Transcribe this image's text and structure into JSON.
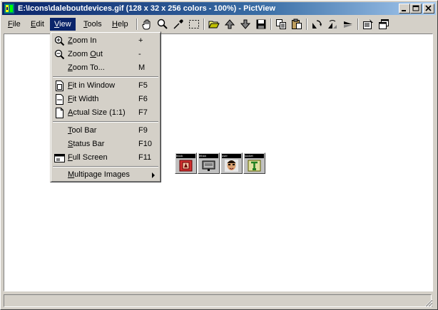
{
  "window": {
    "title": "E:\\Icons\\daleboutdevices.gif (128 x 32 x 256 colors - 100%) - PictView",
    "controls": [
      "minimize",
      "maximize",
      "close"
    ]
  },
  "menubar": {
    "items": [
      {
        "label": "File",
        "accel": "F",
        "rest": "ile"
      },
      {
        "label": "Edit",
        "accel": "E",
        "rest": "dit"
      },
      {
        "label": "View",
        "accel": "V",
        "rest": "iew"
      },
      {
        "label": "Tools",
        "accel": "T",
        "rest": "ools"
      },
      {
        "label": "Help",
        "accel": "H",
        "rest": "elp"
      }
    ]
  },
  "toolbar": {
    "icons": [
      "hand-icon",
      "zoom-icon",
      "eyedropper-icon",
      "selection-icon",
      "open-folder-icon",
      "previous-icon",
      "next-icon",
      "save-icon",
      "copy-icon",
      "paste-icon",
      "rotate-icon",
      "flip-icon",
      "mirror-icon",
      "properties-icon",
      "window-icon"
    ]
  },
  "view_menu": {
    "items": [
      {
        "pre": "",
        "accel": "Z",
        "rest": "oom In",
        "shortcut": "+",
        "icon": "zoom-in-icon"
      },
      {
        "pre": "Zoom ",
        "accel": "O",
        "rest": "ut",
        "shortcut": "-",
        "icon": "zoom-out-icon"
      },
      {
        "pre": "",
        "accel": "Z",
        "rest": "oom To...",
        "shortcut": "M",
        "icon": ""
      },
      {
        "pre": "",
        "accel": "F",
        "rest": "it in Window",
        "shortcut": "F5",
        "icon": "fit-window-icon"
      },
      {
        "pre": "",
        "accel": "F",
        "rest": "it Width",
        "shortcut": "F6",
        "icon": "fit-width-icon"
      },
      {
        "pre": "",
        "accel": "A",
        "rest": "ctual Size (1:1)",
        "shortcut": "F7",
        "icon": "actual-size-icon"
      },
      {
        "pre": "",
        "accel": "T",
        "rest": "ool Bar",
        "shortcut": "F9",
        "icon": ""
      },
      {
        "pre": "",
        "accel": "S",
        "rest": "tatus Bar",
        "shortcut": "F10",
        "icon": ""
      },
      {
        "pre": "",
        "accel": "F",
        "rest": "ull Screen",
        "shortcut": "F11",
        "icon": "full-screen-icon"
      },
      {
        "pre": "",
        "accel": "M",
        "rest": "ultipage Images",
        "shortcut": "",
        "icon": "",
        "submenu": true
      }
    ]
  },
  "image": {
    "thumbs": [
      {
        "header": "block",
        "art": "block-device-art"
      },
      {
        "header": "ethan",
        "art": "network-device-art"
      },
      {
        "header": "user",
        "art": "user-face-art"
      },
      {
        "header": "socket",
        "art": "socket-device-art"
      }
    ]
  },
  "colors": {
    "title_active": "#0a246a",
    "face": "#d4d0c8",
    "client": "#ffffff"
  }
}
